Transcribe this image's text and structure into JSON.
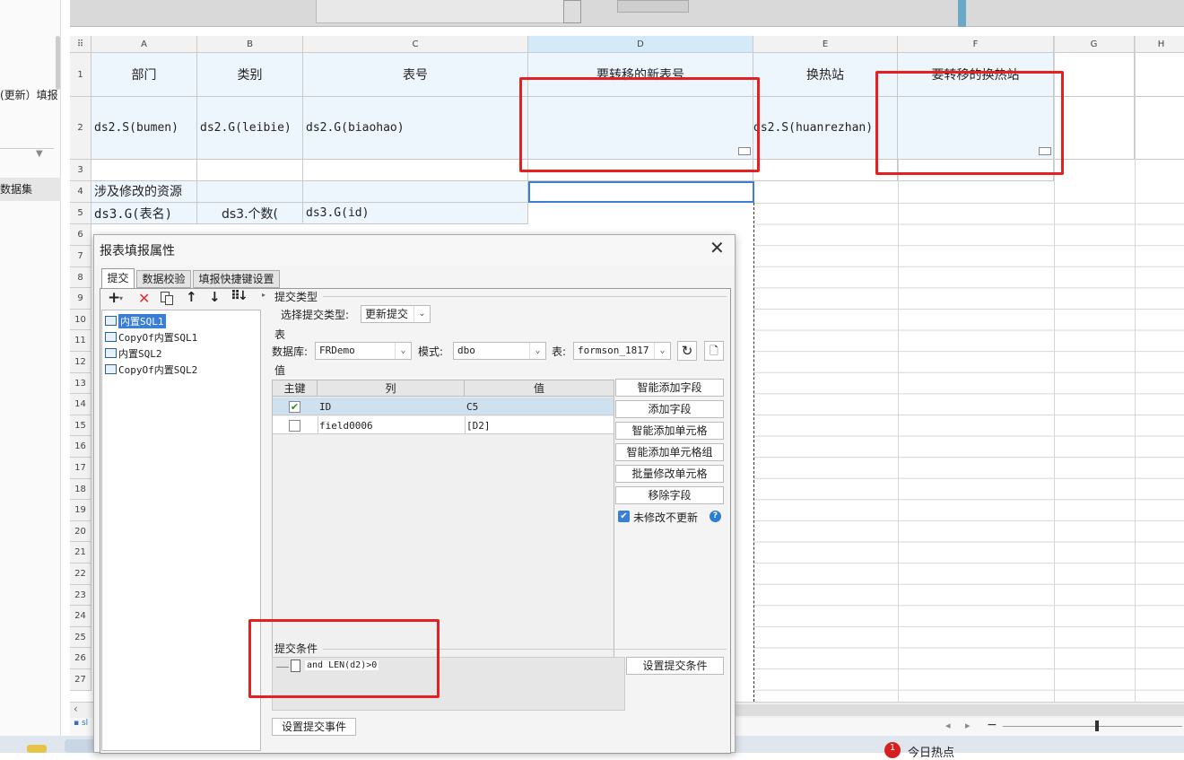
{
  "left_panel": {
    "item1": "(更新）填报",
    "item2": "数据集"
  },
  "columns": [
    "A",
    "B",
    "C",
    "D",
    "E",
    "F",
    "G",
    "H"
  ],
  "rows": [
    "1",
    "2",
    "3",
    "4",
    "5",
    "6",
    "7",
    "8",
    "9",
    "10",
    "11",
    "12",
    "13",
    "14",
    "15",
    "16",
    "17",
    "18",
    "19",
    "20",
    "21",
    "22",
    "23",
    "24",
    "25",
    "26",
    "27"
  ],
  "sheet": {
    "r1": {
      "a": "部门",
      "b": "类别",
      "c": "表号",
      "d": "要转移的新表号",
      "e": "换热站",
      "f": "要转移的换热站"
    },
    "r2": {
      "a": "ds2.S(bumen)",
      "b": "ds2.G(leibie)",
      "c": "ds2.G(biaohao)",
      "e": "ds2.S(huanrezhan)"
    },
    "r4": {
      "a": "涉及修改的资源"
    },
    "r5": {
      "a": "ds3.G(表名)",
      "b": "ds3.个数(",
      "c": "ds3.G(id)"
    }
  },
  "dialog": {
    "title": "报表填报属性",
    "tabs": [
      "提交",
      "数据校验",
      "填报快捷键设置"
    ],
    "tree_items": [
      "内置SQL1",
      "CopyOf内置SQL1",
      "内置SQL2",
      "CopyOf内置SQL2"
    ],
    "submit_type_section": "提交类型",
    "submit_type_label": "选择提交类型:",
    "submit_type_value": "更新提交",
    "table_section": "表",
    "db_label": "数据库:",
    "db_value": "FRDemo",
    "schema_label": "模式:",
    "schema_value": "dbo",
    "table_label": "表:",
    "table_value": "formson_1817",
    "value_section": "值",
    "grid_headers": [
      "主键",
      "列",
      "值"
    ],
    "grid_rows": [
      {
        "key": true,
        "col": "ID",
        "val": "C5"
      },
      {
        "key": false,
        "col": "field0006",
        "val": "[D2]"
      }
    ],
    "side_buttons": [
      "智能添加字段",
      "添加字段",
      "智能添加单元格",
      "智能添加单元格组",
      "批量修改单元格",
      "移除字段"
    ],
    "no_update_label": "未修改不更新",
    "cond_section": "提交条件",
    "cond_text": "and LEN(d2)>0",
    "set_cond_button": "设置提交条件",
    "set_event_button": "设置提交事件"
  },
  "taskbar": {
    "badge": "1",
    "news": "今日热点"
  }
}
